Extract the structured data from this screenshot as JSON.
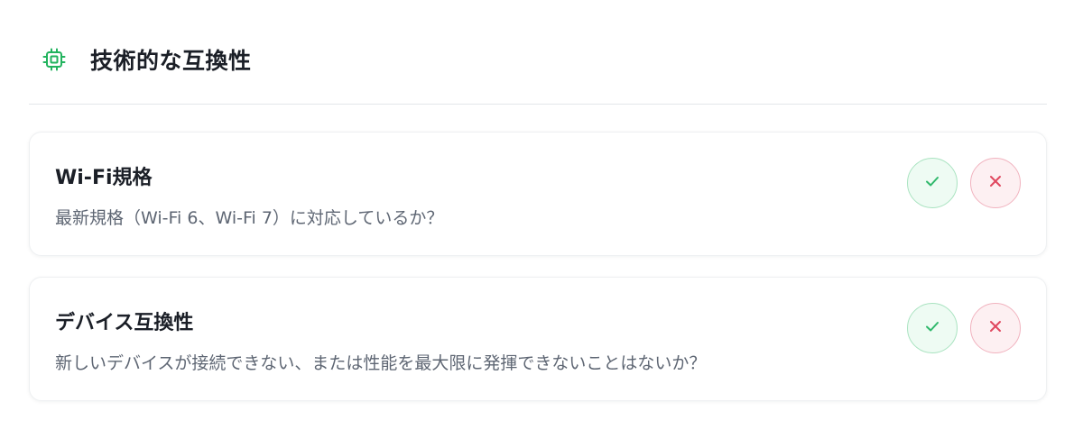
{
  "section": {
    "icon": "chip-icon",
    "title": "技術的な互換性",
    "accent_color": "#22b35e"
  },
  "items": [
    {
      "title": "Wi-Fi規格",
      "description": "最新規格（Wi-Fi 6、Wi-Fi 7）に対応しているか？",
      "confirm_icon": "check-icon",
      "reject_icon": "close-icon"
    },
    {
      "title": "デバイス互換性",
      "description": "新しいデバイスが接続できない、または性能を最大限に発揮できないことはないか？",
      "confirm_icon": "check-icon",
      "reject_icon": "close-icon"
    }
  ],
  "colors": {
    "confirm": "#2fb86b",
    "reject": "#e0485f"
  }
}
